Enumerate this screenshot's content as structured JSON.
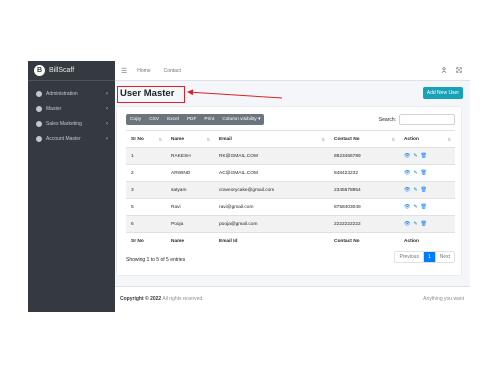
{
  "brand": {
    "logo_letter": "B",
    "name": "BillScaff"
  },
  "sidebar": {
    "items": [
      {
        "label": "Administration",
        "icon": "circle-icon"
      },
      {
        "label": "Master",
        "icon": "circle-icon"
      },
      {
        "label": "Sales Marketing",
        "icon": "circle-icon"
      },
      {
        "label": "Account Master",
        "icon": "circle-icon"
      }
    ]
  },
  "topbar": {
    "menu_icon": "☰",
    "links": [
      "Home",
      "Contact"
    ],
    "right_icons": [
      "user-icon",
      "expand-icon"
    ]
  },
  "page": {
    "title": "User Master",
    "add_button": "Add New User"
  },
  "toolbar": {
    "buttons": [
      "Copy",
      "CSV",
      "Excel",
      "PDF",
      "Print",
      "Column visibility ▾"
    ]
  },
  "search": {
    "label": "Search:",
    "value": ""
  },
  "table": {
    "headers": [
      "Sr No",
      "Name",
      "Email",
      "Contact No",
      "Action"
    ],
    "rows": [
      [
        "1",
        "RAKESH",
        "RK@GMAIL.COM",
        "8823456789"
      ],
      [
        "2",
        "ARWIND",
        "AC@GMAIL.COM",
        "848423232"
      ],
      [
        "3",
        "satyam",
        "craveorycake@gmail.com",
        "2345678954"
      ],
      [
        "5",
        "Ravi",
        "ravi@gmail.com",
        "8758403049"
      ],
      [
        "6",
        "Pooja",
        "pooja@gmail.com",
        "2222222222"
      ]
    ],
    "footer_headers": [
      "Sr No",
      "Name",
      "Email Id",
      "Contact No",
      "Action"
    ]
  },
  "pagination": {
    "info": "Showing 1 to 5 of 5 entries",
    "previous": "Previous",
    "page": "1",
    "next": "Next"
  },
  "footer": {
    "copyright_prefix": "Copyright © 2022",
    "copyright_suffix": "All rights reserved.",
    "right": "Anything you want"
  },
  "colors": {
    "sidebar": "#343a40",
    "accent_teal": "#17a2b8",
    "highlight_red": "#d8232a",
    "primary": "#007bff"
  }
}
